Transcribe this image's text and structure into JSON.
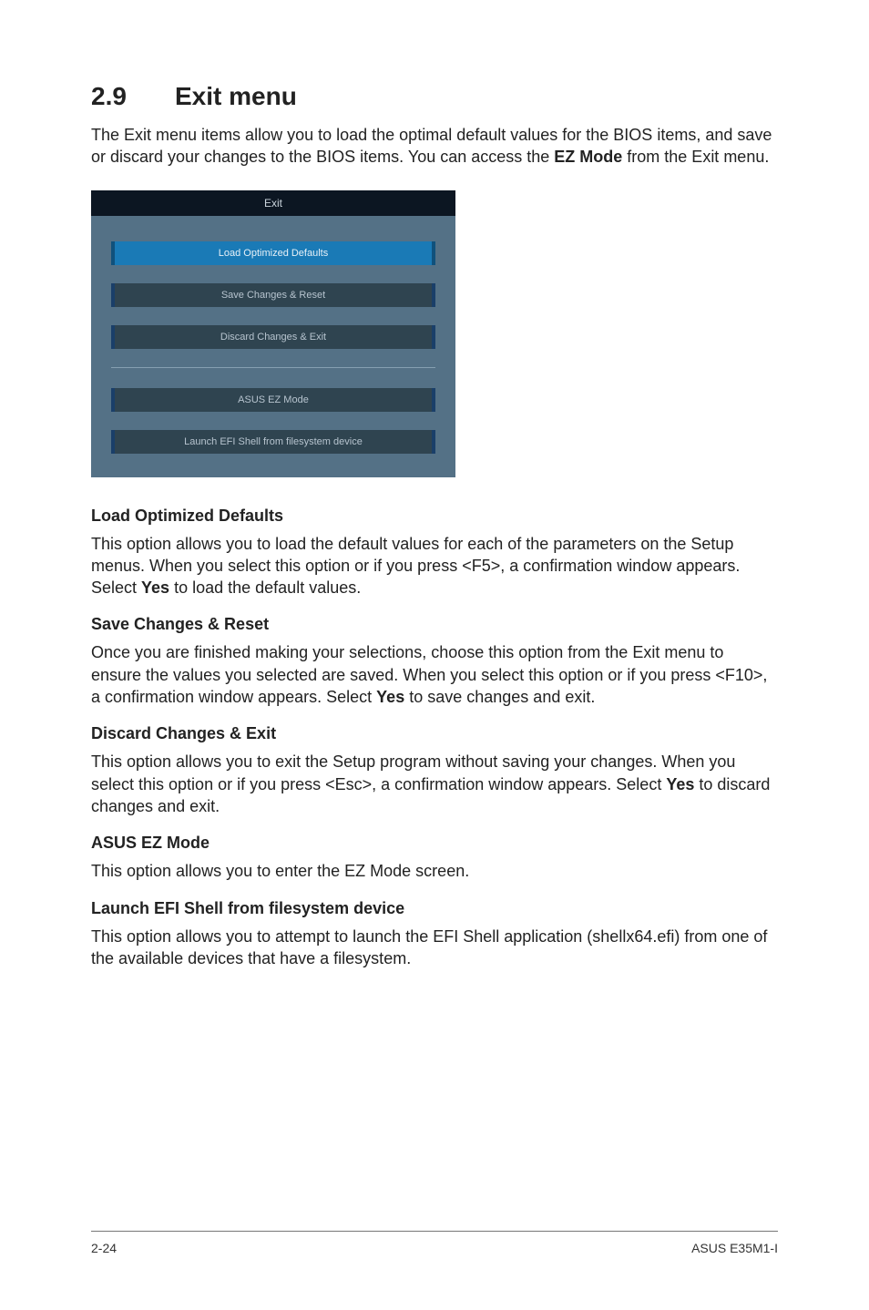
{
  "title": {
    "number": "2.9",
    "text": "Exit menu"
  },
  "intro": {
    "part1": "The Exit menu items allow you to load the optimal default values for the BIOS items, and save or discard your changes to the BIOS items. You can access the ",
    "bold": "EZ Mode",
    "part2": " from the Exit menu."
  },
  "bios": {
    "title": "Exit",
    "buttons": {
      "load": "Load Optimized Defaults",
      "save": "Save Changes & Reset",
      "discard": "Discard Changes & Exit",
      "ezmode": "ASUS EZ Mode",
      "efi": "Launch EFI Shell from filesystem device"
    }
  },
  "sections": {
    "load": {
      "head": "Load Optimized Defaults",
      "p1": "This option allows you to load the default values for each of the parameters on the Setup menus. When you select this option or if you press <F5>, a confirmation window appears. Select ",
      "b1": "Yes",
      "p2": " to load the default values."
    },
    "save": {
      "head": "Save Changes & Reset",
      "p1": "Once you are finished making your selections, choose this option from the Exit menu to ensure the values you selected are saved. When you select this option or if you press <F10>, a confirmation window appears. Select ",
      "b1": "Yes",
      "p2": " to save changes and exit."
    },
    "discard": {
      "head": "Discard Changes & Exit",
      "p1": "This option allows you to exit the Setup program without saving your changes. When you select this option or if you press <Esc>, a confirmation window appears. Select ",
      "b1": "Yes",
      "p2": " to discard changes and exit."
    },
    "ezmode": {
      "head": "ASUS EZ Mode",
      "p": "This option allows you to enter the EZ Mode screen."
    },
    "efi": {
      "head": "Launch EFI Shell from filesystem device",
      "p": "This option allows you to attempt to launch the EFI Shell application (shellx64.efi) from one of the available devices that have a filesystem."
    }
  },
  "footer": {
    "left": "2-24",
    "right": "ASUS E35M1-I"
  }
}
